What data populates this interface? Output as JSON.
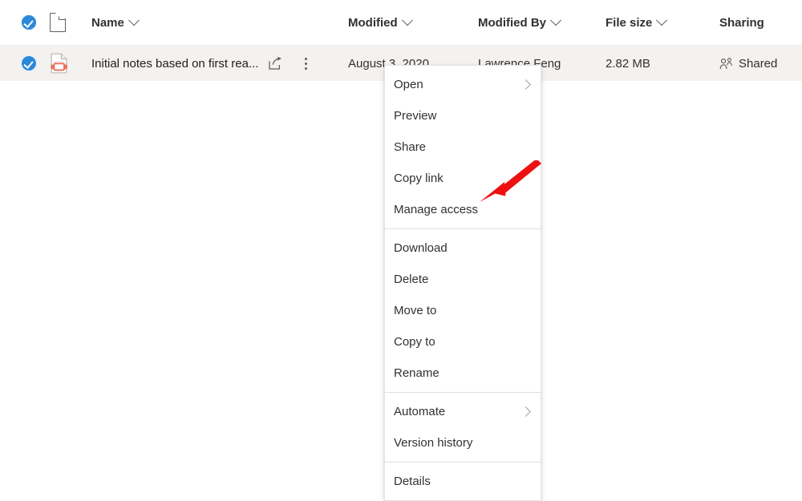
{
  "accent_color": "#2b88d8",
  "row_selected_bg": "#f3f2f1",
  "annotation_color": "#ee1111",
  "file_list": {
    "columns": [
      {
        "key": "select",
        "label": "",
        "sortable": false,
        "icon": "select-all-checkbox"
      },
      {
        "key": "filetype",
        "label": "",
        "sortable": false,
        "icon": "document-icon"
      },
      {
        "key": "name",
        "label": "Name",
        "sortable": true
      },
      {
        "key": "modified",
        "label": "Modified",
        "sortable": true
      },
      {
        "key": "modified_by",
        "label": "Modified By",
        "sortable": true
      },
      {
        "key": "file_size",
        "label": "File size",
        "sortable": true
      },
      {
        "key": "sharing",
        "label": "Sharing",
        "sortable": false
      }
    ],
    "rows": [
      {
        "selected": true,
        "file_icon": "video-file-icon",
        "name": "Initial notes based on first rea...",
        "modified": "August 3, 2020",
        "modified_by": "Lawrence Feng",
        "file_size": "2.82 MB",
        "sharing": "Shared",
        "sharing_icon": "people-icon",
        "actions": [
          {
            "name": "share-button",
            "icon": "share-icon"
          },
          {
            "name": "more-options-button",
            "icon": "ellipsis-vertical-icon"
          }
        ]
      }
    ]
  },
  "context_menu": {
    "groups": [
      {
        "items": [
          {
            "label": "Open",
            "has_submenu": true,
            "name": "open"
          },
          {
            "label": "Preview",
            "has_submenu": false,
            "name": "preview"
          },
          {
            "label": "Share",
            "has_submenu": false,
            "name": "share"
          },
          {
            "label": "Copy link",
            "has_submenu": false,
            "name": "copy-link"
          },
          {
            "label": "Manage access",
            "has_submenu": false,
            "name": "manage-access"
          }
        ]
      },
      {
        "items": [
          {
            "label": "Download",
            "has_submenu": false,
            "name": "download"
          },
          {
            "label": "Delete",
            "has_submenu": false,
            "name": "delete"
          },
          {
            "label": "Move to",
            "has_submenu": false,
            "name": "move-to"
          },
          {
            "label": "Copy to",
            "has_submenu": false,
            "name": "copy-to"
          },
          {
            "label": "Rename",
            "has_submenu": false,
            "name": "rename"
          }
        ]
      },
      {
        "items": [
          {
            "label": "Automate",
            "has_submenu": true,
            "name": "automate"
          },
          {
            "label": "Version history",
            "has_submenu": false,
            "name": "version-history"
          }
        ]
      },
      {
        "items": [
          {
            "label": "Details",
            "has_submenu": false,
            "name": "details"
          }
        ]
      }
    ]
  },
  "annotation": {
    "type": "arrow",
    "points_to": "Manage access"
  }
}
